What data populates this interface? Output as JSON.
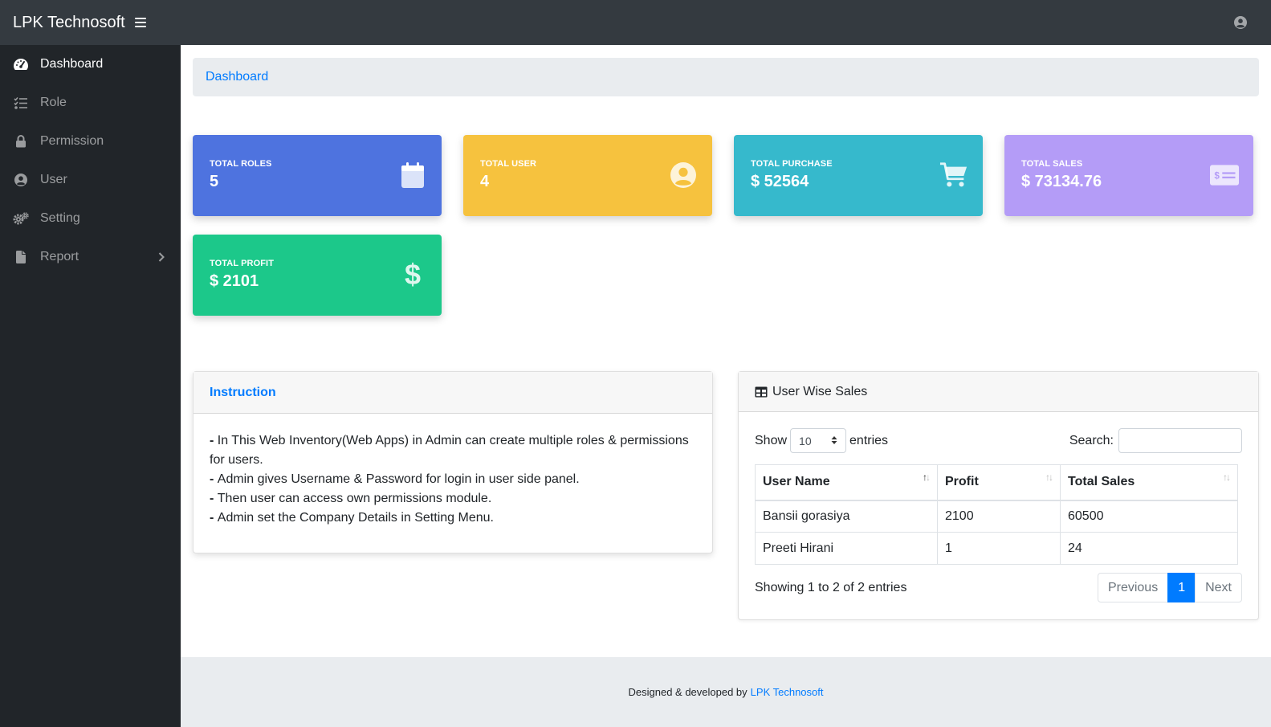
{
  "app": {
    "brand": "LPK Technosoft"
  },
  "sidebar": {
    "items": [
      {
        "label": "Dashboard",
        "icon": "tachometer-icon"
      },
      {
        "label": "Role",
        "icon": "tasks-icon"
      },
      {
        "label": "Permission",
        "icon": "lock-icon"
      },
      {
        "label": "User",
        "icon": "user-circle-icon"
      },
      {
        "label": "Setting",
        "icon": "cogs-icon"
      },
      {
        "label": "Report",
        "icon": "file-icon"
      }
    ]
  },
  "breadcrumb": {
    "current": "Dashboard"
  },
  "stats": [
    {
      "label": "TOTAL ROLES",
      "value": "5",
      "color": "#4e73df",
      "icon": "calendar-icon"
    },
    {
      "label": "TOTAL USER",
      "value": "4",
      "color": "#f6c23e",
      "icon": "user-circle-icon"
    },
    {
      "label": "TOTAL PURCHASE",
      "value": "$ 52564",
      "color": "#36b9cc",
      "icon": "shopping-cart-icon"
    },
    {
      "label": "TOTAL SALES",
      "value": "$ 73134.76",
      "color": "#b49cf7",
      "icon": "money-check-icon"
    },
    {
      "label": "TOTAL PROFIT",
      "value": "$ 2101",
      "color": "#1cc88a",
      "icon": "dollar-icon"
    }
  ],
  "instruction": {
    "title": "Instruction",
    "lines": [
      "In This Web Inventory(Web Apps) in Admin can create multiple roles & permissions for users.",
      "Admin gives Username & Password for login in user side panel.",
      "Then user can access own permissions module.",
      "Admin set the Company Details in Setting Menu."
    ]
  },
  "sales_table": {
    "title": "User Wise Sales",
    "show_label": "Show",
    "entries_label": "entries",
    "page_size": "10",
    "search_label": "Search:",
    "search_value": "",
    "columns": [
      "User Name",
      "Profit",
      "Total Sales"
    ],
    "rows": [
      [
        "Bansii gorasiya",
        "2100",
        "60500"
      ],
      [
        "Preeti Hirani",
        "1",
        "24"
      ]
    ],
    "info": "Showing 1 to 2 of 2 entries",
    "pagination": {
      "previous": "Previous",
      "current": "1",
      "next": "Next"
    }
  },
  "footer": {
    "text": "Designed & developed by",
    "link": "LPK Technosoft"
  }
}
